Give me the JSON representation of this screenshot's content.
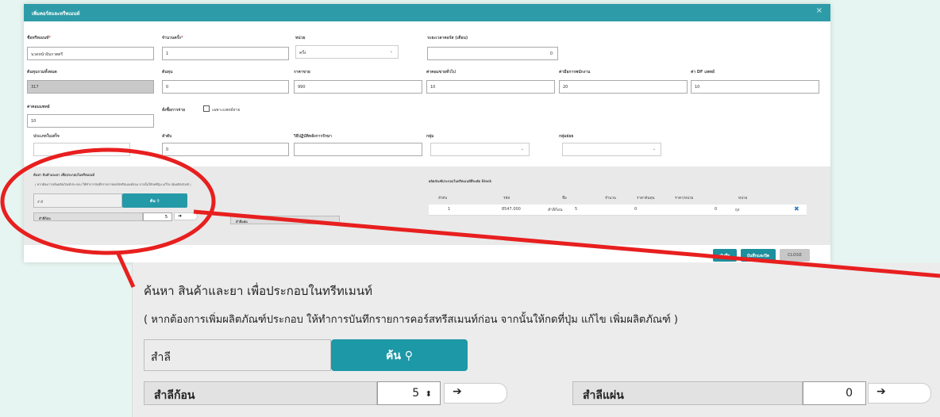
{
  "dialog": {
    "title": "เพิ่มคอร์สและทรีทเมนท์",
    "close_glyph": "×",
    "fields": {
      "treatment_name": {
        "label": "ชื่อทรีทเมนท์",
        "required_mark": "*",
        "value": "นวดหน้าอินราตตรี"
      },
      "count": {
        "label": "จำนวนครั้ง",
        "required_mark": "*",
        "value": "1"
      },
      "unit": {
        "label": "หน่วย",
        "value": "ครั้ง"
      },
      "duration": {
        "label": "ระยะเวลาคอร์ส (เดือน)",
        "value": "0"
      },
      "cost_total": {
        "label": "ต้นทุนรวมทั้งหมด",
        "value": "317"
      },
      "cost": {
        "label": "ต้นทุน",
        "value": "0"
      },
      "price": {
        "label": "ราคาขาย",
        "value": "990"
      },
      "sales_commission": {
        "label": "ค่าคอมขายทั่วไป",
        "value": "10"
      },
      "staff_fee": {
        "label": "ค่ามือการพนักงาน",
        "value": "20"
      },
      "doctor_df": {
        "label": "ค่า DF แพทย์",
        "value": "10"
      },
      "doctor_commission": {
        "label": "ค่าคอมแพทย์",
        "value": "10"
      },
      "order_type_label": "สั่งซื้อการจ่าย",
      "doctor_only_label": "เฉพาะแพทย์จ่าย",
      "receipt_type": {
        "label": "ประเภทใบเสร็จ",
        "value": ""
      },
      "order": {
        "label": "ลำดับ",
        "value": "0"
      },
      "treatment_usage": {
        "label": "วิธีปฏิบัติหลังการรักษา",
        "value": ""
      },
      "group": {
        "label": "กลุ่ม",
        "value": ""
      },
      "subgroup": {
        "label": "กลุ่มย่อย",
        "value": ""
      }
    },
    "search_section": {
      "title": "ค้นหา สินค้าและยา เพื่อประกอบในทรีทเมนท์",
      "hint": "( หากต้องการเพิ่มผลิตภัณฑ์ประกอบ ให้ทำการบันทึกรายการคอร์สทรีสเมนท์ก่อน จากนั้นให้กดที่ปุ่ม แก้ไข เพิ่มผลิตภัณฑ์ )",
      "search_term": "สำลี",
      "search_button": "ค้น",
      "item_1": {
        "label": "สำลีก้อน",
        "qty": "5"
      },
      "item_2": {
        "label": "สำลีแผ่น",
        "qty": "0"
      },
      "arrow_glyph": "➔"
    },
    "product_table": {
      "title": "ผลิตภัณฑ์ประกอบในทรีทเมนท์ที่จะตัด Stock",
      "headers": [
        "ลำดับ",
        "รหัส",
        "ชื่อ",
        "จำนวน",
        "ราคาต้นทุน",
        "ราคา/หน่วย",
        "หน่วย"
      ],
      "rows": [
        {
          "no": "1",
          "code": "8547.000",
          "name": "สำลีก้อน",
          "qty": "5",
          "cost": "0",
          "unit_price": "0",
          "unit": "ถุง",
          "delete_glyph": "✖"
        }
      ]
    },
    "footer": {
      "save": "บันทึก",
      "save_close": "บันทึกและปิด",
      "close": "CLOSE"
    }
  },
  "zoom": {
    "title": "ค้นหา สินค้าและยา เพื่อประกอบในทรีทเมนท์",
    "hint": "( หากต้องการเพิ่มผลิตภัณฑ์ประกอบ ให้ทำการบันทึกรายการคอร์สทรีสเมนท์ก่อน จากนั้นให้กดที่ปุ่ม แก้ไข เพิ่มผลิตภัณฑ์ )",
    "search_term": "สำลี",
    "search_button": "ค้น",
    "item_1": {
      "label": "สำลีก้อน",
      "qty": "5"
    },
    "item_2": {
      "label": "สำลีแผ่น",
      "qty": "0"
    },
    "arrow_glyph": "➔",
    "spin_glyph": "⬍"
  },
  "colors": {
    "teal": "#2e9ca8",
    "accent_button": "#1c98a6",
    "callout_red": "#e81f1f",
    "background": "#e6f5f1"
  }
}
